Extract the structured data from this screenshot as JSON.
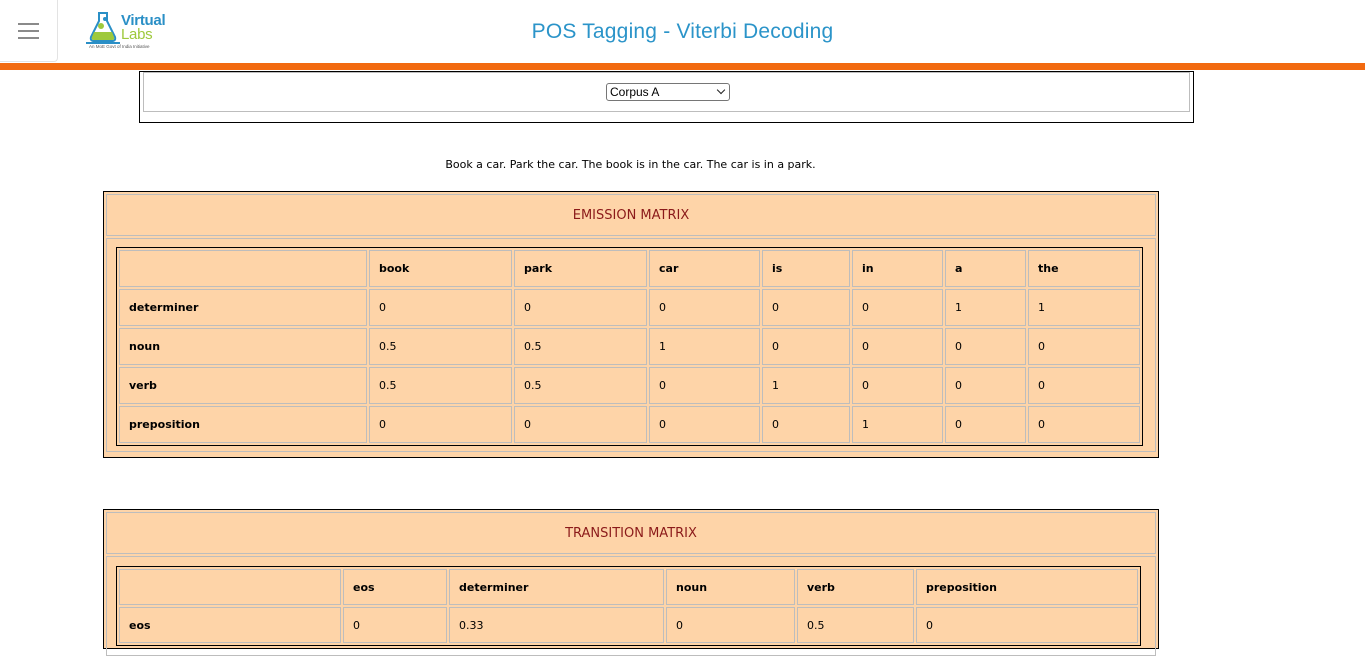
{
  "header": {
    "title": "POS Tagging - Viterbi Decoding",
    "logo": {
      "line1": "Virtual",
      "line2": "Labs",
      "tagline": "An MoE Govt of India Initiative"
    },
    "accent_color": "#f26a10",
    "title_color": "#2b94c9"
  },
  "corpus": {
    "selected": "Corpus A",
    "sentence": "Book a car. Park the car. The book is in the car. The car is in a park."
  },
  "emission": {
    "title": "EMISSION MATRIX",
    "columns": [
      "",
      "book",
      "park",
      "car",
      "is",
      "in",
      "a",
      "the"
    ],
    "rows": [
      [
        "determiner",
        "0",
        "0",
        "0",
        "0",
        "0",
        "1",
        "1"
      ],
      [
        "noun",
        "0.5",
        "0.5",
        "1",
        "0",
        "0",
        "0",
        "0"
      ],
      [
        "verb",
        "0.5",
        "0.5",
        "0",
        "1",
        "0",
        "0",
        "0"
      ],
      [
        "preposition",
        "0",
        "0",
        "0",
        "0",
        "1",
        "0",
        "0"
      ]
    ]
  },
  "transition": {
    "title": "TRANSITION MATRIX",
    "columns": [
      "",
      "eos",
      "determiner",
      "noun",
      "verb",
      "preposition"
    ],
    "rows": [
      [
        "eos",
        "0",
        "0.33",
        "0",
        "0.5",
        "0"
      ]
    ]
  },
  "colors": {
    "panel_bg": "#fed4a8",
    "panel_title": "#8b1a1a"
  }
}
